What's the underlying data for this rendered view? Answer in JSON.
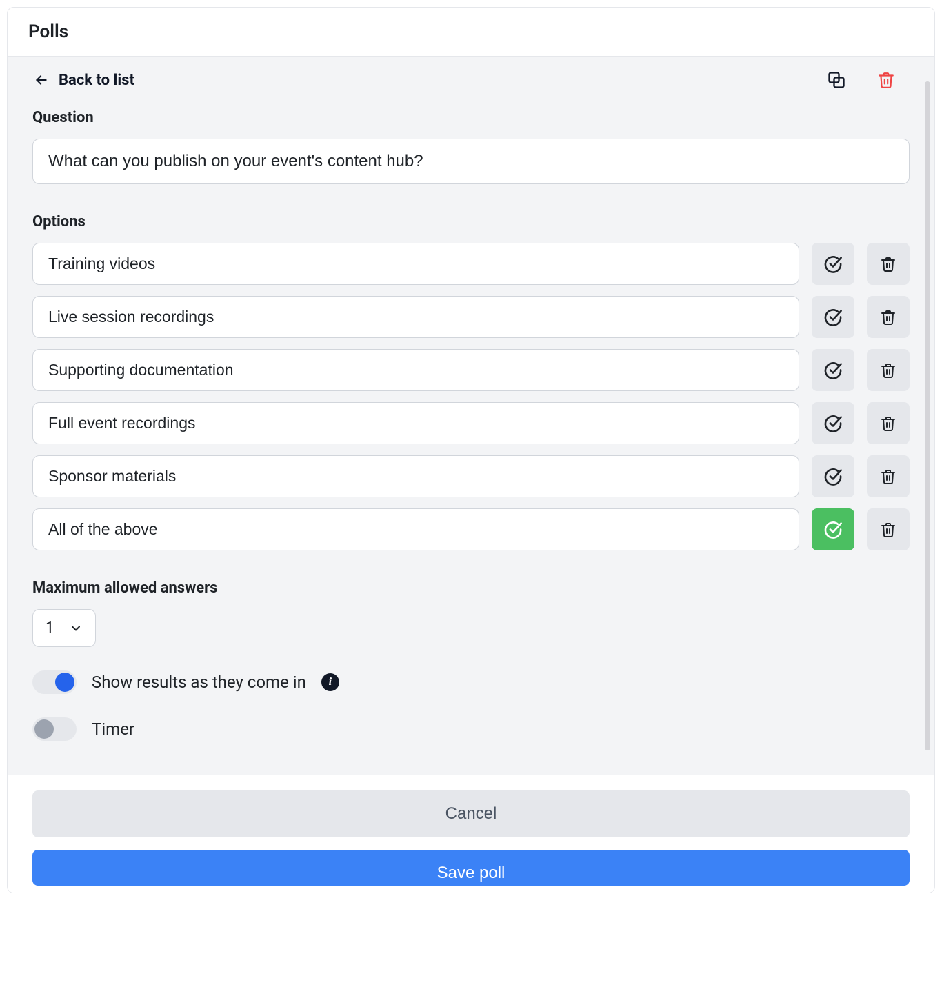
{
  "header": {
    "title": "Polls"
  },
  "back": {
    "label": "Back to list"
  },
  "sections": {
    "question_label": "Question",
    "options_label": "Options",
    "max_answers_label": "Maximum allowed answers",
    "show_results_label": "Show results as they come in",
    "timer_label": "Timer"
  },
  "question": {
    "value": "What can you publish on your event's content hub?"
  },
  "options": [
    {
      "value": "Training videos",
      "correct": false
    },
    {
      "value": "Live session recordings",
      "correct": false
    },
    {
      "value": "Supporting documentation",
      "correct": false
    },
    {
      "value": "Full event recordings",
      "correct": false
    },
    {
      "value": "Sponsor materials",
      "correct": false
    },
    {
      "value": "All of the above",
      "correct": true
    }
  ],
  "max_answers": {
    "value": "1"
  },
  "toggles": {
    "show_results": true,
    "timer": false
  },
  "footer": {
    "cancel_label": "Cancel",
    "save_label": "Save poll"
  }
}
